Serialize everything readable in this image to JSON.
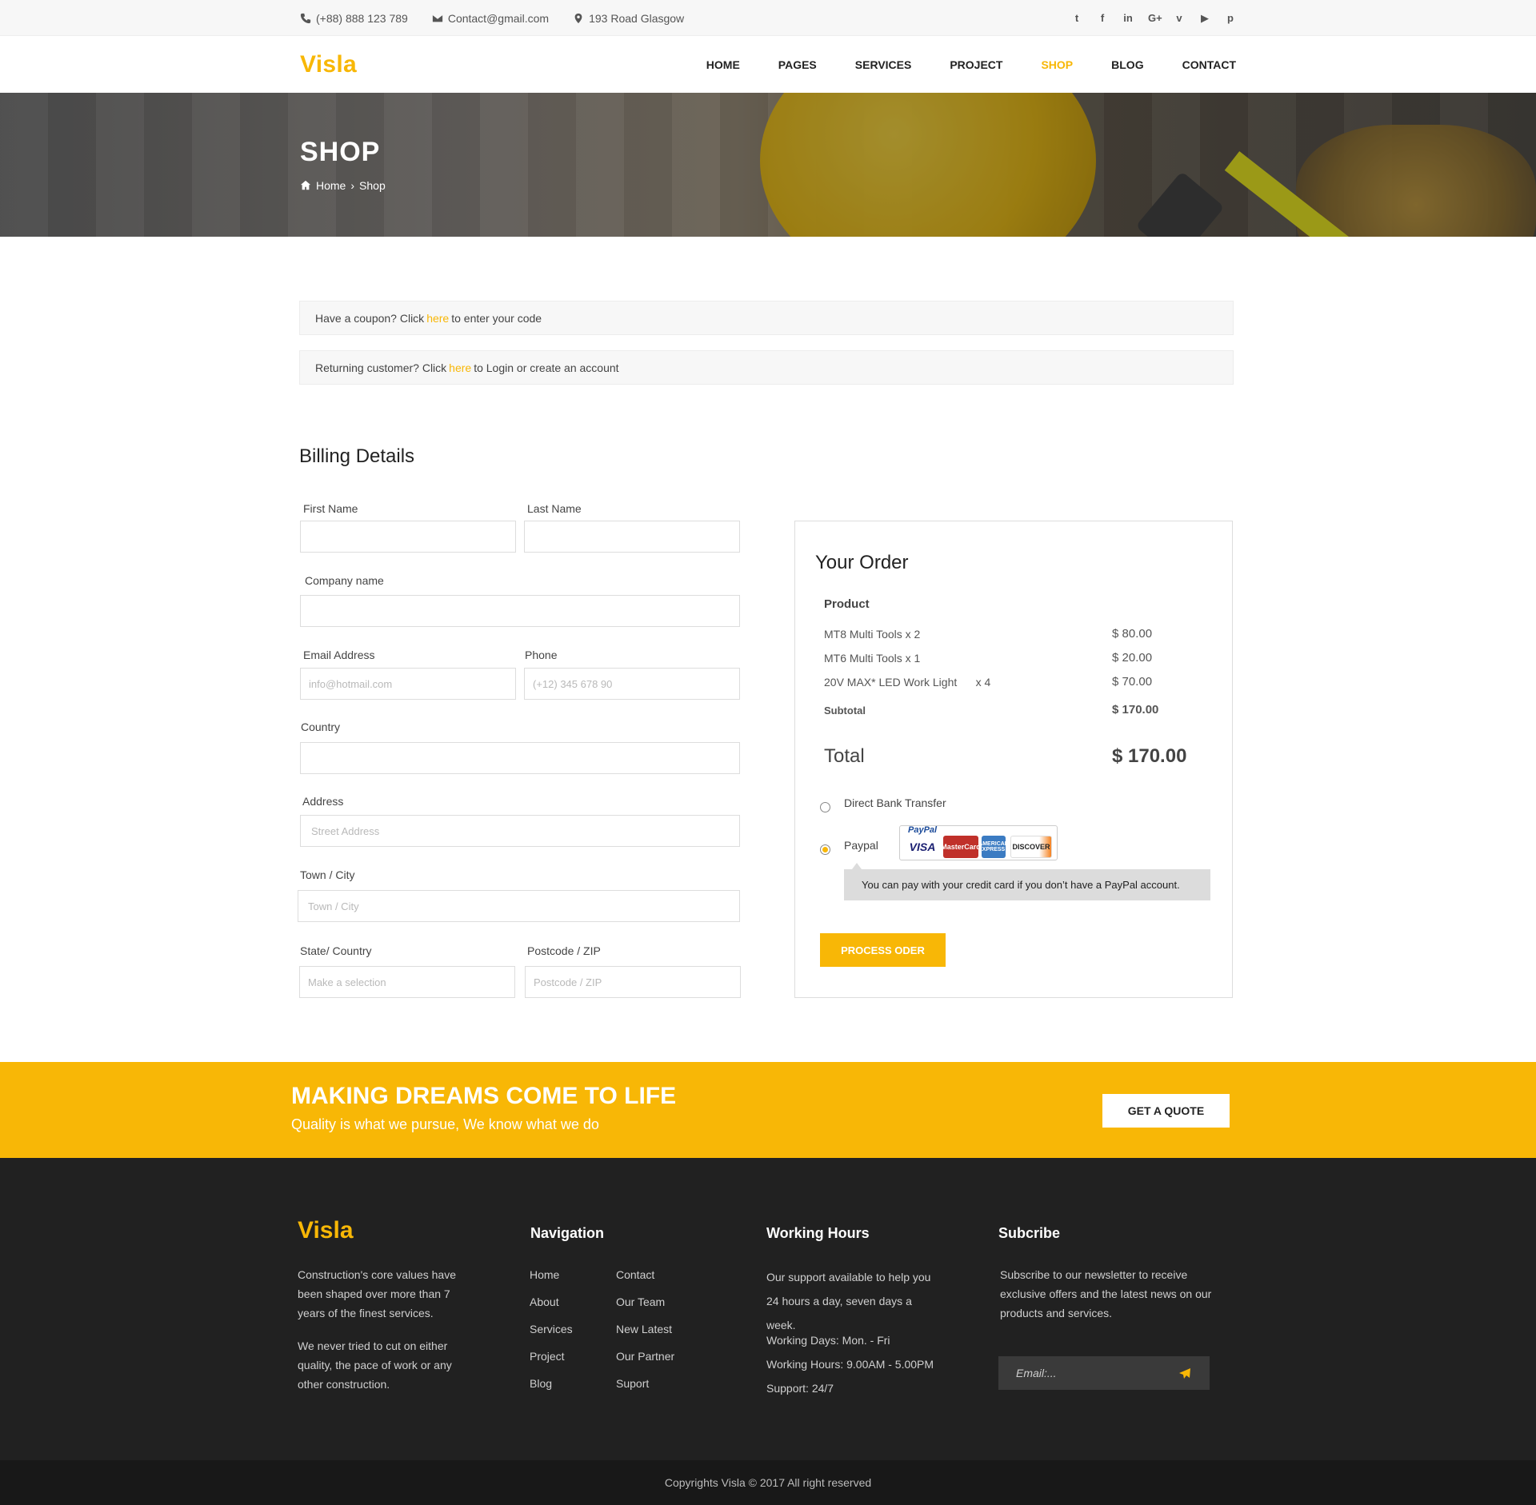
{
  "topbar": {
    "phone": "(+88) 888 123 789",
    "email": "Contact@gmail.com",
    "address": "193 Road Glasgow",
    "socials": [
      "twitter-icon",
      "facebook-icon",
      "linkedin-icon",
      "google-plus-icon",
      "vimeo-icon",
      "youtube-icon",
      "pinterest-icon"
    ],
    "social_glyphs": [
      "t",
      "f",
      "in",
      "G+",
      "v",
      "▶",
      "p"
    ]
  },
  "header": {
    "logo": "Visla",
    "nav": [
      "HOME",
      "PAGES",
      "SERVICES",
      "PROJECT",
      "SHOP",
      "BLOG",
      "CONTACT"
    ],
    "active": "SHOP"
  },
  "banner": {
    "title": "SHOP",
    "breadcrumb_home": "Home",
    "breadcrumb_sep": "›",
    "breadcrumb_current": "Shop"
  },
  "notices": {
    "coupon_prefix": "Have a coupon? Click",
    "coupon_link": "here",
    "coupon_suffix": "to enter your code",
    "returning_prefix": "Returning customer? Click",
    "returning_link": "here",
    "returning_suffix": "to Login or create an account"
  },
  "billing": {
    "title": "Billing Details",
    "first_name_label": "First Name",
    "last_name_label": "Last Name",
    "company_label": "Company name",
    "email_label": "Email Address",
    "email_placeholder": "info@hotmail.com",
    "phone_label": "Phone",
    "phone_placeholder": "(+12) 345 678 90",
    "country_label": "Country",
    "address_label": "Address",
    "address_placeholder": "Street Address",
    "town_label": "Town / City",
    "town_placeholder": "Town / City",
    "state_label": "State/ Country",
    "state_placeholder": "Make a selection",
    "postcode_label": "Postcode / ZIP",
    "postcode_placeholder": "Postcode / ZIP"
  },
  "order": {
    "title": "Your Order",
    "product_header": "Product",
    "items": [
      {
        "name": "MT8 Multi Tools   x 2",
        "price": "$ 80.00"
      },
      {
        "name": "MT6 Multi Tools   x 1",
        "price": "$ 20.00"
      },
      {
        "name": "20V MAX* LED Work Light      x 4",
        "price": "$ 70.00"
      }
    ],
    "subtotal_label": "Subtotal",
    "subtotal": "$ 170.00",
    "total_label": "Total",
    "total": "$ 170.00",
    "payment_bank": "Direct Bank Transfer",
    "payment_paypal": "Paypal",
    "paypal_mark": "PayPal",
    "cards": [
      "VISA",
      "MasterCard",
      "AMERICAN EXPRESS",
      "DISCOVER"
    ],
    "paypal_note": "You can pay with your credit card if you don’t have a PayPal account.",
    "process_button": "PROCESS ODER",
    "selected_payment": "Paypal"
  },
  "cta": {
    "title": "MAKING DREAMS COME TO LIFE",
    "subtitle": "Quality is what we pursue, We know what we do",
    "button": "GET A QUOTE"
  },
  "footer": {
    "logo": "Visla",
    "about_1": "Construction's core values have been shaped over more than 7 years of  the finest services.",
    "about_2": "We never tried to cut on either quality, the pace of work or any other construction.",
    "nav_title": "Navigation",
    "nav_col1": [
      "Home",
      "About",
      "Services",
      "Project",
      "Blog"
    ],
    "nav_col2": [
      "Contact",
      "Our Team",
      "New Latest",
      "Our Partner",
      "Suport"
    ],
    "hours_title": "Working Hours",
    "hours_text": "Our support available to help you 24 hours a day, seven days a week.",
    "hours_days": "Working Days: Mon. - Fri",
    "hours_time": "Working Hours: 9.00AM - 5.00PM",
    "hours_support": "Support: 24/7",
    "subscribe_title": "Subcribe",
    "subscribe_text": "Subscribe to our newsletter to receive exclusive offers and the latest news on our products and services.",
    "subscribe_placeholder": "Email:...",
    "copyright": "Copyrights Visla  ©  2017 All right reserved"
  },
  "colors": {
    "accent": "#f8b706",
    "footer_bg": "#212121",
    "copyright_bg": "#181818"
  }
}
